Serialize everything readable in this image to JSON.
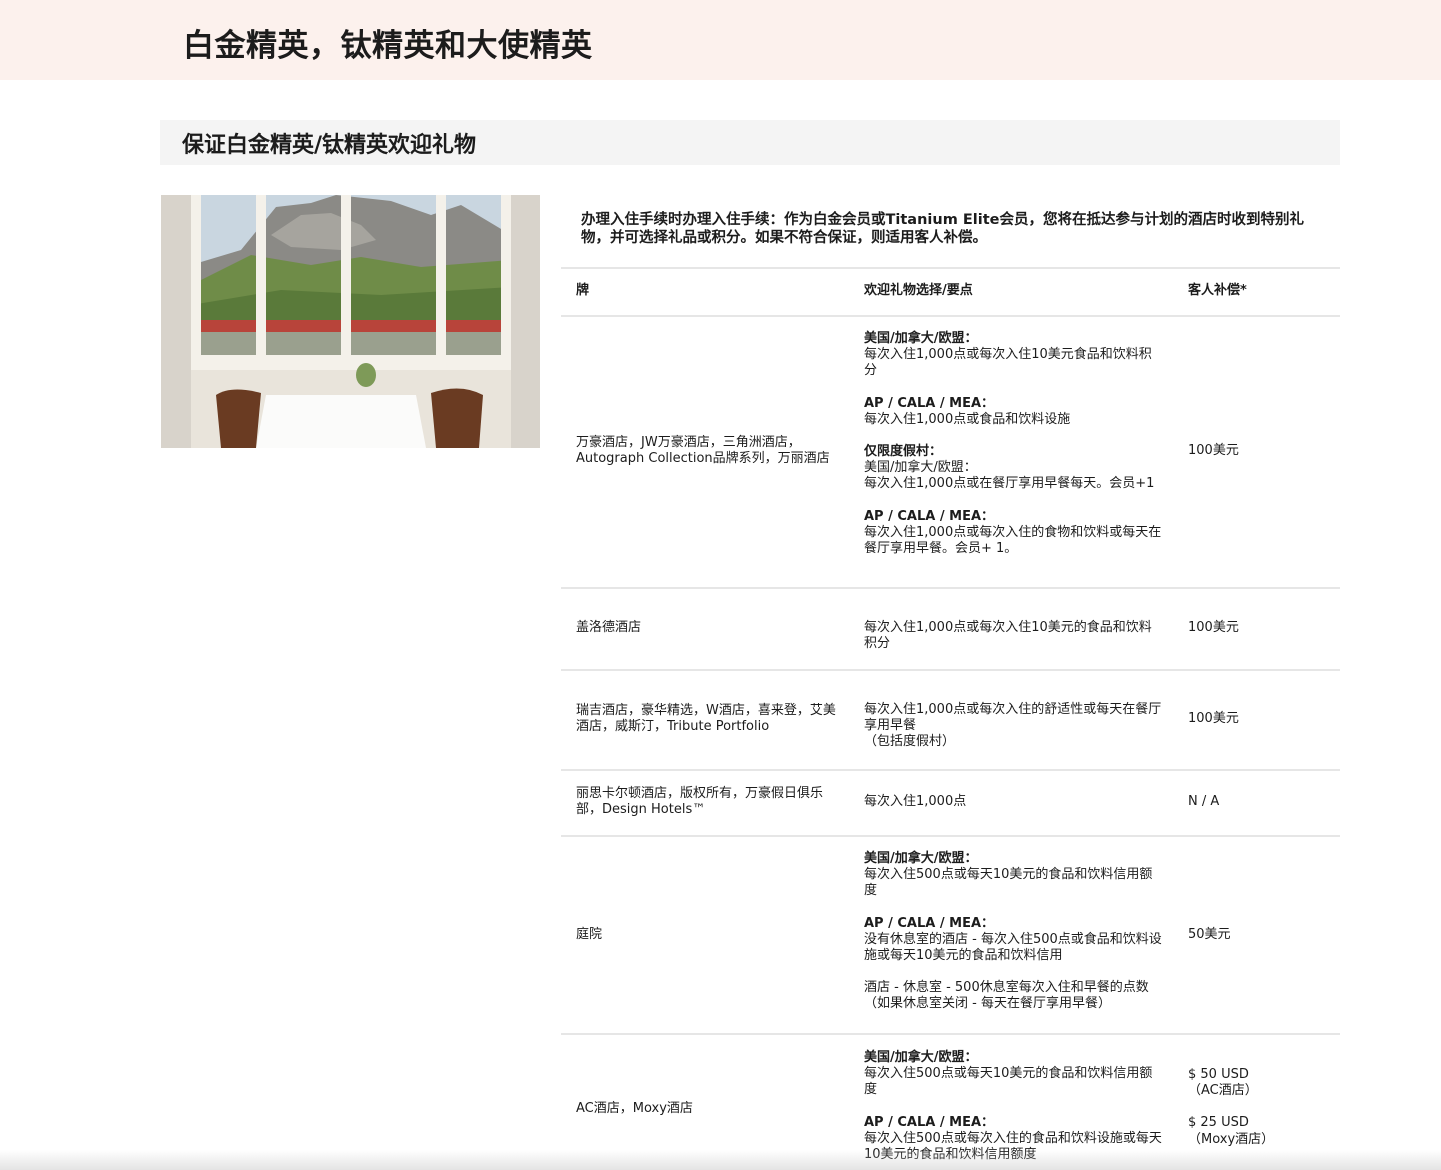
{
  "page": {
    "title": "白金精英，钛精英和大使精英",
    "section_title": "保证白金精英/钛精英欢迎礼物",
    "intro": "办理入住手续时办理入住手续：作为白金会员或Titanium Elite会员，您将在抵达参与计划的酒店时收到特别礼物，并可选择礼品或积分。如果不符合保证，则适用客人补偿。"
  },
  "table": {
    "headers": {
      "brand": "牌",
      "gift": "欢迎礼物选择/要点",
      "compensation": "客人补偿*"
    },
    "rows": [
      {
        "brand": "万豪酒店，JW万豪酒店，三角洲酒店，Autograph Collection品牌系列，万丽酒店",
        "gift": [
          {
            "label": "美国/加拿大/欧盟：",
            "text": "每次入住1,000点或每次入住10美元食品和饮料积分"
          },
          {
            "label": "AP / CALA / MEA：",
            "text": "每次入住1,000点或食品和饮料设施"
          },
          {
            "label": "仅限度假村：",
            "text": "美国/加拿大/欧盟：\n每次入住1,000点或在餐厅享用早餐每天。会员+1"
          },
          {
            "label": "AP / CALA / MEA：",
            "text": "每次入住1,000点或每次入住的食物和饮料或每天在餐厅享用早餐。会员+ 1。"
          }
        ],
        "compensation": [
          "100美元"
        ]
      },
      {
        "brand": "盖洛德酒店",
        "gift": [
          {
            "label": "",
            "text": "每次入住1,000点或每次入住10美元的食品和饮料积分"
          }
        ],
        "compensation": [
          "100美元"
        ]
      },
      {
        "brand": "瑞吉酒店，豪华精选，W酒店，喜来登，艾美酒店，威斯汀，Tribute Portfolio",
        "gift": [
          {
            "label": "",
            "text": "每次入住1,000点或每次入住的舒适性或每天在餐厅享用早餐\n（包括度假村）"
          }
        ],
        "compensation": [
          "100美元"
        ]
      },
      {
        "brand": "丽思卡尔顿酒店，版权所有，万豪假日俱乐部，Design Hotels™",
        "gift": [
          {
            "label": "",
            "text": "每次入住1,000点"
          }
        ],
        "compensation": [
          "N / A"
        ]
      },
      {
        "brand": "庭院",
        "gift": [
          {
            "label": "美国/加拿大/欧盟：",
            "text": "每次入住500点或每天10美元的食品和饮料信用额度"
          },
          {
            "label": "AP / CALA / MEA：",
            "text": "没有休息室的酒店 - 每次入住500点或食品和饮料设施或每天10美元的食品和饮料信用"
          },
          {
            "label": "",
            "text": "酒店 - 休息室 - 500休息室每次入住和早餐的点数（如果休息室关闭 - 每天在餐厅享用早餐）"
          }
        ],
        "compensation": [
          "50美元"
        ]
      },
      {
        "brand": "AC酒店，Moxy酒店",
        "gift": [
          {
            "label": "美国/加拿大/欧盟：",
            "text": "每次入住500点或每天10美元的食品和饮料信用额度"
          },
          {
            "label": "AP / CALA / MEA：",
            "text": "每次入住500点或每次入住的食品和饮料设施或每天10美元的食品和饮料信用额度"
          }
        ],
        "compensation": [
          "$ 50 USD\n（AC酒店）",
          "$ 25 USD\n（Moxy酒店）"
        ]
      }
    ]
  }
}
